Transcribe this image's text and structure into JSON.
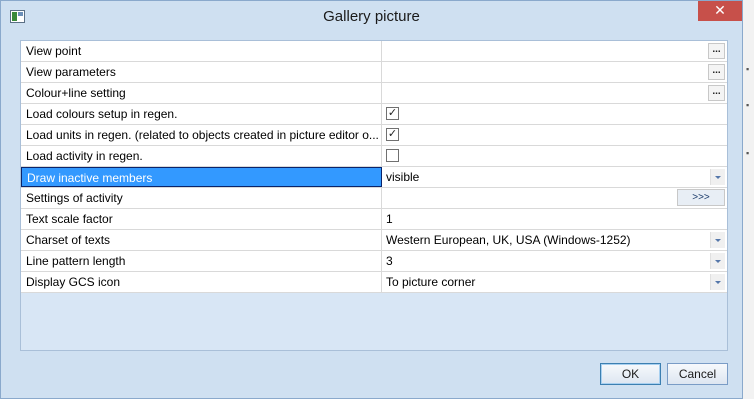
{
  "window": {
    "title": "Gallery picture",
    "close_glyph": "✕"
  },
  "rows": [
    {
      "label": "View point",
      "value": "",
      "control": "ellipsis"
    },
    {
      "label": "View parameters",
      "value": "",
      "control": "ellipsis"
    },
    {
      "label": "Colour+line setting",
      "value": "",
      "control": "ellipsis"
    },
    {
      "label": "Load colours setup in regen.",
      "value": "",
      "control": "checkbox",
      "checked": true
    },
    {
      "label": "Load units in regen. (related to objects created in picture editor o...",
      "value": "",
      "control": "checkbox",
      "checked": true
    },
    {
      "label": "Load activity in regen.",
      "value": "",
      "control": "checkbox",
      "checked": false
    },
    {
      "label": "Draw inactive members",
      "value": "visible",
      "control": "dropdown",
      "selected": true
    },
    {
      "label": "Settings of activity",
      "value": "",
      "control": "more"
    },
    {
      "label": "Text scale factor",
      "value": "1",
      "control": "none"
    },
    {
      "label": "Charset of texts",
      "value": "Western European, UK, USA (Windows-1252)",
      "control": "dropdown"
    },
    {
      "label": "Line pattern length",
      "value": "3",
      "control": "dropdown"
    },
    {
      "label": "Display GCS icon",
      "value": "To picture corner",
      "control": "dropdown"
    }
  ],
  "controls": {
    "ellipsis_label": "...",
    "more_label": ">>>",
    "check_glyph": "✓"
  },
  "buttons": {
    "ok": "OK",
    "cancel": "Cancel"
  }
}
